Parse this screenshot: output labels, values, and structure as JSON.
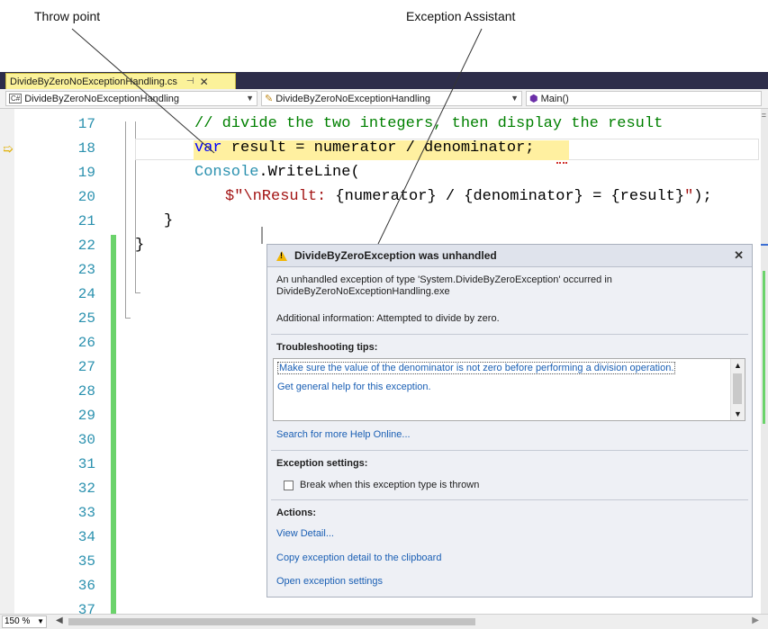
{
  "callouts": {
    "throw_point": "Throw point",
    "exception_assistant": "Exception Assistant"
  },
  "tab": {
    "filename": "DivideByZeroNoExceptionHandling.cs",
    "pin_icon": "pin-icon",
    "close_icon": "close-icon"
  },
  "nav": {
    "project": "DivideByZeroNoExceptionHandling",
    "class": "DivideByZeroNoExceptionHandling",
    "member": "Main()"
  },
  "editor": {
    "line_numbers": [
      "17",
      "18",
      "19",
      "20",
      "21",
      "22",
      "23",
      "24",
      "25",
      "26",
      "27",
      "28",
      "29",
      "30",
      "31",
      "32",
      "33",
      "34",
      "35",
      "36",
      "37"
    ],
    "current_line": "18",
    "line17": "// divide the two integers, then display the result",
    "line18_kw": "var",
    "line18_rest": " result = numerator / denominator;",
    "line19_type": "Console",
    "line19_rest": ".WriteLine(",
    "line20_str1": "$\"\\nResult: ",
    "line20_mid1": "{numerator} / {denominator} = {result}",
    "line20_str2": "\"",
    "line20_end": ");",
    "line21": "}",
    "line22": "}"
  },
  "status": {
    "zoom": "150 %"
  },
  "assistant": {
    "title": "DivideByZeroException was unhandled",
    "message_line1": "An unhandled exception of type 'System.DivideByZeroException' occurred in",
    "message_line2": "DivideByZeroNoExceptionHandling.exe",
    "additional": "Additional information: Attempted to divide by zero.",
    "tips_heading": "Troubleshooting tips:",
    "tips": [
      "Make sure the value of the denominator is not zero before performing a division operation.",
      "Get general help for this exception."
    ],
    "search_online": "Search for more Help Online...",
    "settings_heading": "Exception settings:",
    "break_label": "Break when this exception type is thrown",
    "break_checked": false,
    "actions_heading": "Actions:",
    "actions": [
      "View Detail...",
      "Copy exception detail to the clipboard",
      "Open exception settings"
    ],
    "colors": {
      "link": "#1a5fb4",
      "warning": "#f2b705",
      "highlight": "#fff0a0",
      "changed_line_bar": "#6bd36b"
    }
  }
}
